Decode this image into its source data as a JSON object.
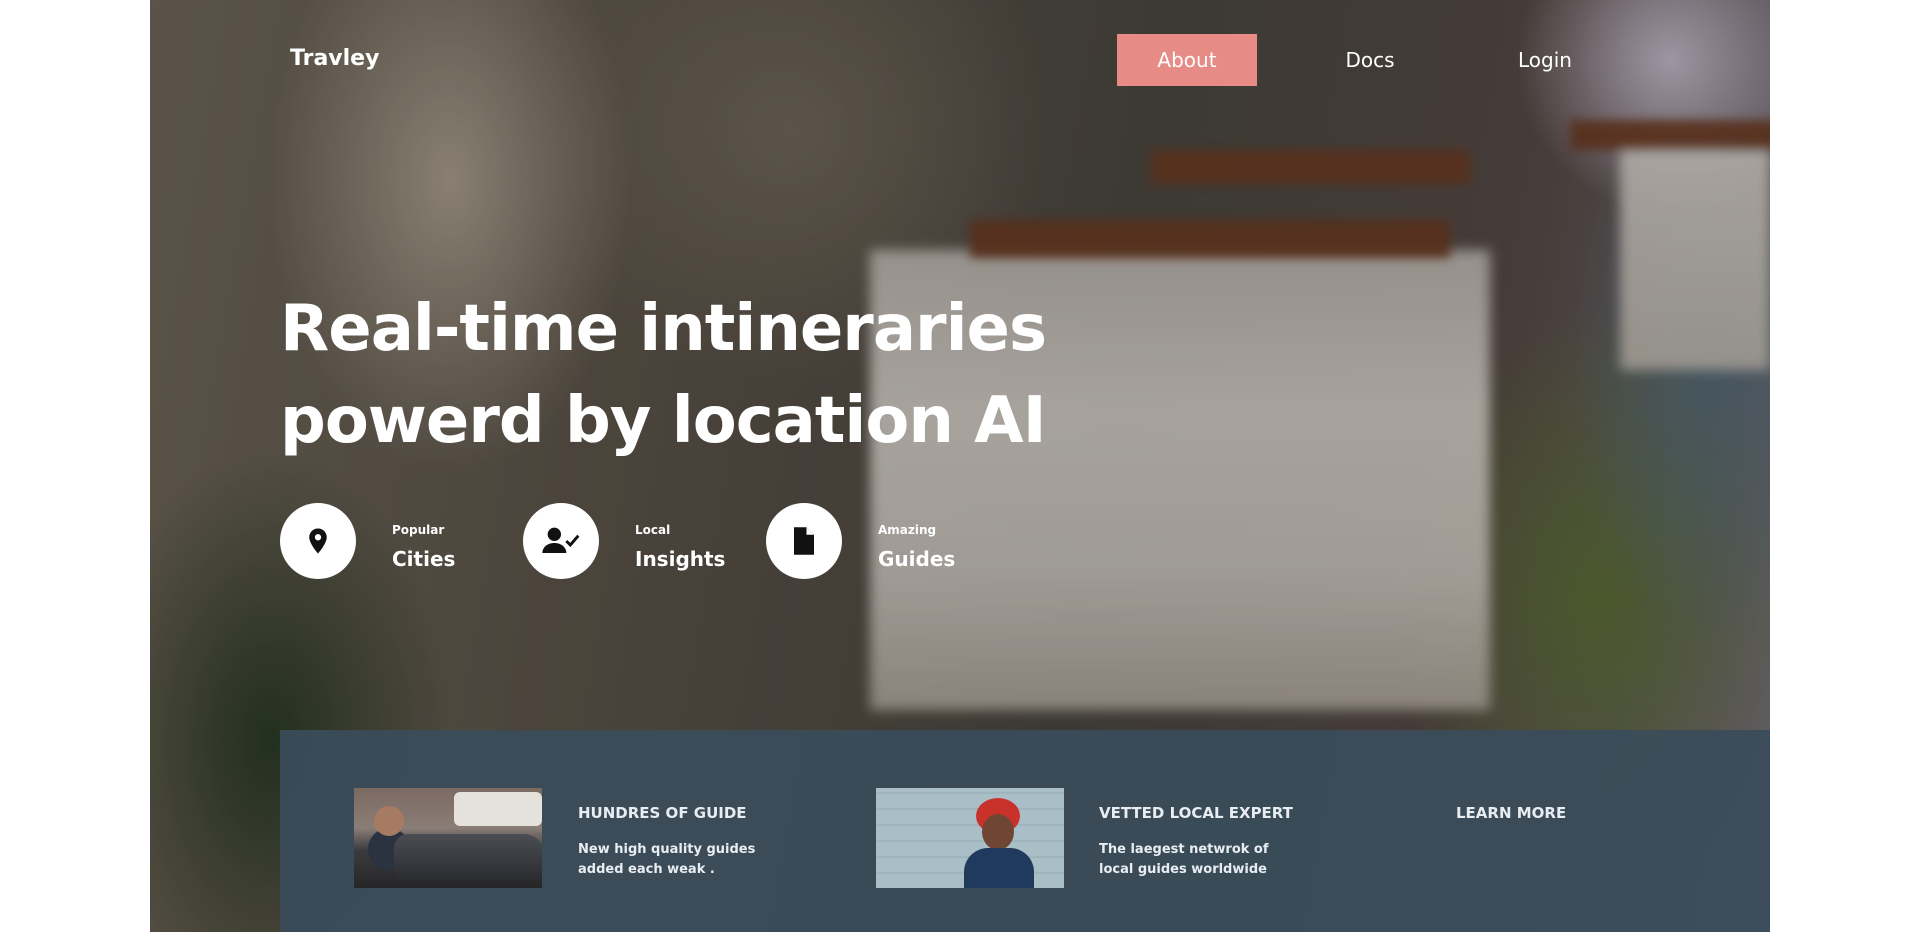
{
  "nav": {
    "logo": "Travley",
    "about": "About",
    "docs": "Docs",
    "login": "Login",
    "about_bg": "#e78b86"
  },
  "hero": {
    "headline_line1": "Real-time intineraries",
    "headline_line2": "powerd by location AI"
  },
  "features": [
    {
      "icon": "location-pin-icon",
      "small": "Popular",
      "big": "Cities"
    },
    {
      "icon": "user-check-icon",
      "small": "Local",
      "big": "Insights"
    },
    {
      "icon": "document-icon",
      "small": "Amazing",
      "big": "Guides"
    }
  ],
  "band": {
    "bg": "#3a4c5a",
    "cards": [
      {
        "title": "HUNDRES OF GUIDE",
        "line1": "New high quality guides",
        "line2": "added each weak ."
      },
      {
        "title": "VETTED LOCAL EXPERT",
        "line1": "The laegest netwrok of",
        "line2": "local guides worldwide"
      }
    ],
    "learn_more": "LEARN MORE"
  }
}
